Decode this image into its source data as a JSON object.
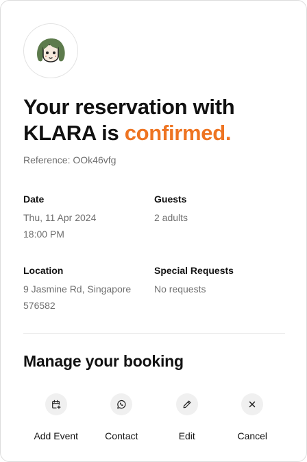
{
  "header": {
    "headline_prefix": "Your reservation with KLARA is",
    "headline_accent": "confirmed.",
    "reference": "Reference: OOk46vfg",
    "accent_color": "#ee7422"
  },
  "details": {
    "date": {
      "label": "Date",
      "line1": "Thu, 11 Apr 2024",
      "line2": "18:00 PM"
    },
    "guests": {
      "label": "Guests",
      "line1": "2 adults"
    },
    "location": {
      "label": "Location",
      "line1": "9 Jasmine Rd, Singapore",
      "line2": "576582"
    },
    "special": {
      "label": "Special Requests",
      "line1": "No requests"
    }
  },
  "manage": {
    "title": "Manage your booking",
    "actions": [
      {
        "label": "Add Event",
        "icon": "calendar-plus-icon"
      },
      {
        "label": "Contact",
        "icon": "whatsapp-icon"
      },
      {
        "label": "Edit",
        "icon": "pencil-icon"
      },
      {
        "label": "Cancel",
        "icon": "close-icon"
      }
    ]
  }
}
